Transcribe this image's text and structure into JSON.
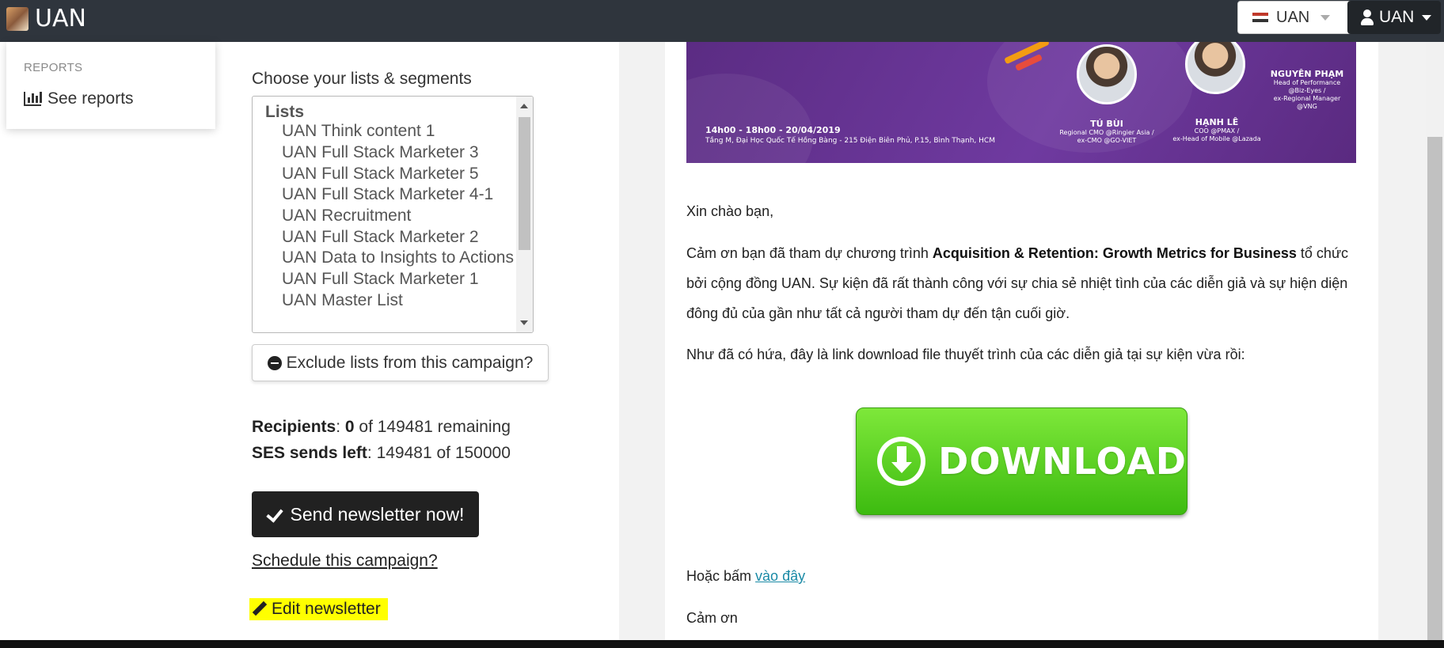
{
  "navbar": {
    "brand": "UAN",
    "account_switcher": "UAN",
    "user_menu": "UAN"
  },
  "sidebar": {
    "section_heading": "REPORTS",
    "items": [
      {
        "label": "See reports",
        "icon": "bar-chart-icon"
      }
    ]
  },
  "campaign": {
    "lists_label": "Choose your lists & segments",
    "lists_group": "Lists",
    "lists": [
      "UAN Think content 1",
      "UAN Full Stack Marketer 3",
      "UAN Full Stack Marketer 5",
      "UAN Full Stack Marketer 4-1",
      "UAN Recruitment",
      "UAN Full Stack Marketer 2",
      "UAN Data to Insights to Actions",
      "UAN Full Stack Marketer 1",
      "UAN Master List"
    ],
    "exclude_button": "Exclude lists from this campaign?",
    "recipients_label": "Recipients",
    "recipients_count": "0",
    "recipients_rest": "of 149481 remaining",
    "ses_label": "SES sends left",
    "ses_value": "149481 of 150000",
    "send_button": "Send newsletter now!",
    "schedule_link": "Schedule this campaign?",
    "edit_link": "Edit newsletter"
  },
  "email": {
    "banner": {
      "speakers": [
        {
          "name": "TÚ BÙI",
          "role_line1": "Regional CMO @Ringier Asia /",
          "role_line2": "ex-CMO @GO-VIET"
        },
        {
          "name": "HẠNH LÊ",
          "role_line1": "COO @PMAX /",
          "role_line2": "ex-Head of Mobile @Lazada"
        },
        {
          "name": "NGUYÊN PHẠM",
          "role_line1": "Head of Performance",
          "role_line2": "@Biz-Eyes /",
          "role_line3": "ex-Regional Manager",
          "role_line4": "@VNG"
        }
      ],
      "time": "14h00 - 18h00 -  20/04/2019",
      "address": "Tầng M, Đại Học Quốc Tế Hồng Bàng - 215 Điện Biên Phủ, P.15, Bình Thạnh, HCM"
    },
    "greeting": "Xin chào bạn,",
    "para1_start": "Cảm ơn bạn đã tham dự chương trình ",
    "para1_bold": "Acquisition & Retention: Growth Metrics for Business",
    "para1_end": " tổ chức bởi cộng đồng UAN. Sự kiện đã rất thành công với sự chia sẻ nhiệt tình của các diễn giả và sự hiện diện đông đủ của gần như tất cả người tham dự đến tận cuối giờ.",
    "para2": "Như đã có hứa, đây là link download file thuyết trình của các diễn giả tại sự kiện vừa rồi:",
    "download_label": "DOWNLOAD",
    "alt_prefix": "Hoặc bấm ",
    "alt_link": "vào đây",
    "closing": "Cảm ơn"
  },
  "colors": {
    "navbar": "#2f353d",
    "send_button": "#212121",
    "highlight": "#ffff00",
    "download_green": "#4fcc1f",
    "banner_purple": "#6a359a",
    "link": "#1a8aa6"
  }
}
